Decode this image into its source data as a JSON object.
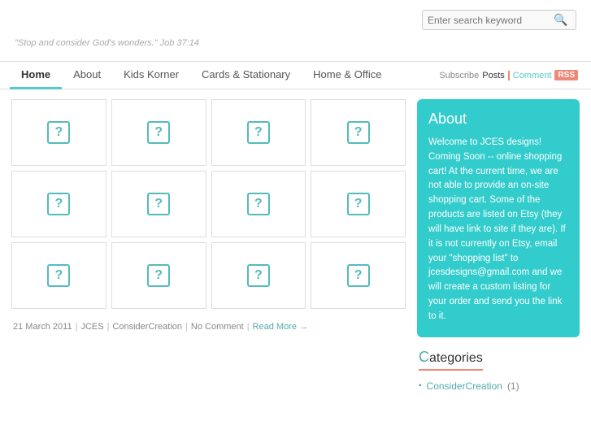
{
  "header": {
    "search_placeholder": "Enter search keyword"
  },
  "tagline": {
    "text": "\"Stop and consider God's wonders.\" Job 37:14"
  },
  "nav": {
    "items": [
      {
        "label": "Home",
        "active": true
      },
      {
        "label": "About",
        "active": false
      },
      {
        "label": "Kids Korner",
        "active": false
      },
      {
        "label": "Cards & Stationary",
        "active": false
      },
      {
        "label": "Home & Office",
        "active": false
      }
    ],
    "subscribe_label": "Subscribe",
    "posts_label": "Posts",
    "comment_label": "Comment",
    "rss_label": "RSS"
  },
  "grid": {
    "rows": [
      [
        true,
        true,
        true,
        true
      ],
      [
        true,
        true,
        true,
        true
      ],
      [
        true,
        true,
        true,
        true
      ]
    ]
  },
  "post_meta": {
    "date": "21 March 2011",
    "author": "JCES",
    "category": "ConsiderCreation",
    "comments": "No Comment",
    "read_more": "Read More →"
  },
  "sidebar": {
    "about": {
      "title": "About",
      "text": "Welcome to JCES designs! Coming Soon -- online shopping cart! At the current time, we are not able to provide an on-site shopping cart. Some of the products are listed on Etsy (they will have link to site if they are). If it is not currently on Etsy, email your \"shopping list\" to jcesdesigns@gmail.com and we will create a custom listing for your order and send you the link to it."
    },
    "categories": {
      "title": "Categories",
      "title_first_char": "C",
      "title_rest": "ategories",
      "items": [
        {
          "label": "ConsiderCreation",
          "count": "(1)"
        }
      ]
    }
  },
  "colors": {
    "teal": "#3cc",
    "orange": "#e87"
  }
}
